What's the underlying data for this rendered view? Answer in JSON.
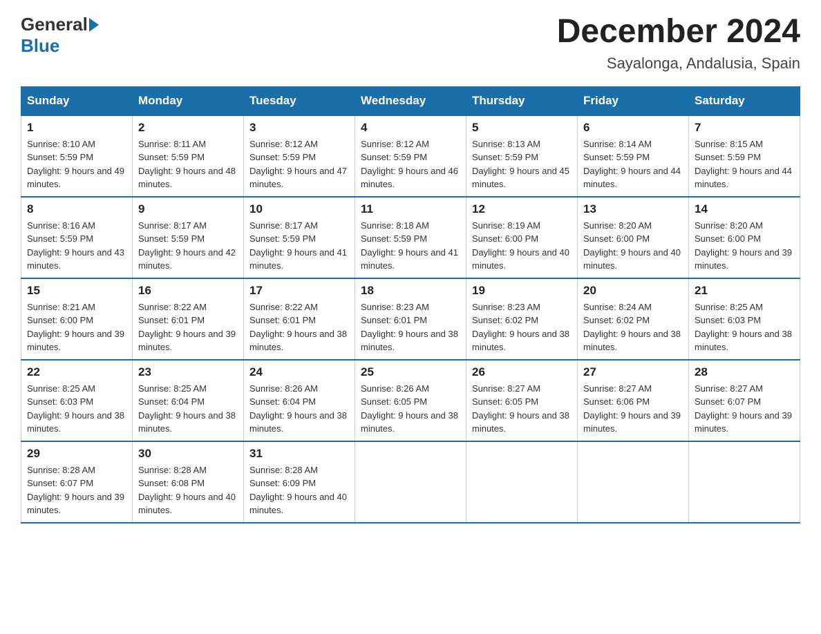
{
  "header": {
    "logo_general": "General",
    "logo_blue": "Blue",
    "month_title": "December 2024",
    "subtitle": "Sayalonga, Andalusia, Spain"
  },
  "days_of_week": [
    "Sunday",
    "Monday",
    "Tuesday",
    "Wednesday",
    "Thursday",
    "Friday",
    "Saturday"
  ],
  "weeks": [
    [
      {
        "day": "1",
        "sunrise": "8:10 AM",
        "sunset": "5:59 PM",
        "daylight": "9 hours and 49 minutes."
      },
      {
        "day": "2",
        "sunrise": "8:11 AM",
        "sunset": "5:59 PM",
        "daylight": "9 hours and 48 minutes."
      },
      {
        "day": "3",
        "sunrise": "8:12 AM",
        "sunset": "5:59 PM",
        "daylight": "9 hours and 47 minutes."
      },
      {
        "day": "4",
        "sunrise": "8:12 AM",
        "sunset": "5:59 PM",
        "daylight": "9 hours and 46 minutes."
      },
      {
        "day": "5",
        "sunrise": "8:13 AM",
        "sunset": "5:59 PM",
        "daylight": "9 hours and 45 minutes."
      },
      {
        "day": "6",
        "sunrise": "8:14 AM",
        "sunset": "5:59 PM",
        "daylight": "9 hours and 44 minutes."
      },
      {
        "day": "7",
        "sunrise": "8:15 AM",
        "sunset": "5:59 PM",
        "daylight": "9 hours and 44 minutes."
      }
    ],
    [
      {
        "day": "8",
        "sunrise": "8:16 AM",
        "sunset": "5:59 PM",
        "daylight": "9 hours and 43 minutes."
      },
      {
        "day": "9",
        "sunrise": "8:17 AM",
        "sunset": "5:59 PM",
        "daylight": "9 hours and 42 minutes."
      },
      {
        "day": "10",
        "sunrise": "8:17 AM",
        "sunset": "5:59 PM",
        "daylight": "9 hours and 41 minutes."
      },
      {
        "day": "11",
        "sunrise": "8:18 AM",
        "sunset": "5:59 PM",
        "daylight": "9 hours and 41 minutes."
      },
      {
        "day": "12",
        "sunrise": "8:19 AM",
        "sunset": "6:00 PM",
        "daylight": "9 hours and 40 minutes."
      },
      {
        "day": "13",
        "sunrise": "8:20 AM",
        "sunset": "6:00 PM",
        "daylight": "9 hours and 40 minutes."
      },
      {
        "day": "14",
        "sunrise": "8:20 AM",
        "sunset": "6:00 PM",
        "daylight": "9 hours and 39 minutes."
      }
    ],
    [
      {
        "day": "15",
        "sunrise": "8:21 AM",
        "sunset": "6:00 PM",
        "daylight": "9 hours and 39 minutes."
      },
      {
        "day": "16",
        "sunrise": "8:22 AM",
        "sunset": "6:01 PM",
        "daylight": "9 hours and 39 minutes."
      },
      {
        "day": "17",
        "sunrise": "8:22 AM",
        "sunset": "6:01 PM",
        "daylight": "9 hours and 38 minutes."
      },
      {
        "day": "18",
        "sunrise": "8:23 AM",
        "sunset": "6:01 PM",
        "daylight": "9 hours and 38 minutes."
      },
      {
        "day": "19",
        "sunrise": "8:23 AM",
        "sunset": "6:02 PM",
        "daylight": "9 hours and 38 minutes."
      },
      {
        "day": "20",
        "sunrise": "8:24 AM",
        "sunset": "6:02 PM",
        "daylight": "9 hours and 38 minutes."
      },
      {
        "day": "21",
        "sunrise": "8:25 AM",
        "sunset": "6:03 PM",
        "daylight": "9 hours and 38 minutes."
      }
    ],
    [
      {
        "day": "22",
        "sunrise": "8:25 AM",
        "sunset": "6:03 PM",
        "daylight": "9 hours and 38 minutes."
      },
      {
        "day": "23",
        "sunrise": "8:25 AM",
        "sunset": "6:04 PM",
        "daylight": "9 hours and 38 minutes."
      },
      {
        "day": "24",
        "sunrise": "8:26 AM",
        "sunset": "6:04 PM",
        "daylight": "9 hours and 38 minutes."
      },
      {
        "day": "25",
        "sunrise": "8:26 AM",
        "sunset": "6:05 PM",
        "daylight": "9 hours and 38 minutes."
      },
      {
        "day": "26",
        "sunrise": "8:27 AM",
        "sunset": "6:05 PM",
        "daylight": "9 hours and 38 minutes."
      },
      {
        "day": "27",
        "sunrise": "8:27 AM",
        "sunset": "6:06 PM",
        "daylight": "9 hours and 39 minutes."
      },
      {
        "day": "28",
        "sunrise": "8:27 AM",
        "sunset": "6:07 PM",
        "daylight": "9 hours and 39 minutes."
      }
    ],
    [
      {
        "day": "29",
        "sunrise": "8:28 AM",
        "sunset": "6:07 PM",
        "daylight": "9 hours and 39 minutes."
      },
      {
        "day": "30",
        "sunrise": "8:28 AM",
        "sunset": "6:08 PM",
        "daylight": "9 hours and 40 minutes."
      },
      {
        "day": "31",
        "sunrise": "8:28 AM",
        "sunset": "6:09 PM",
        "daylight": "9 hours and 40 minutes."
      },
      null,
      null,
      null,
      null
    ]
  ]
}
